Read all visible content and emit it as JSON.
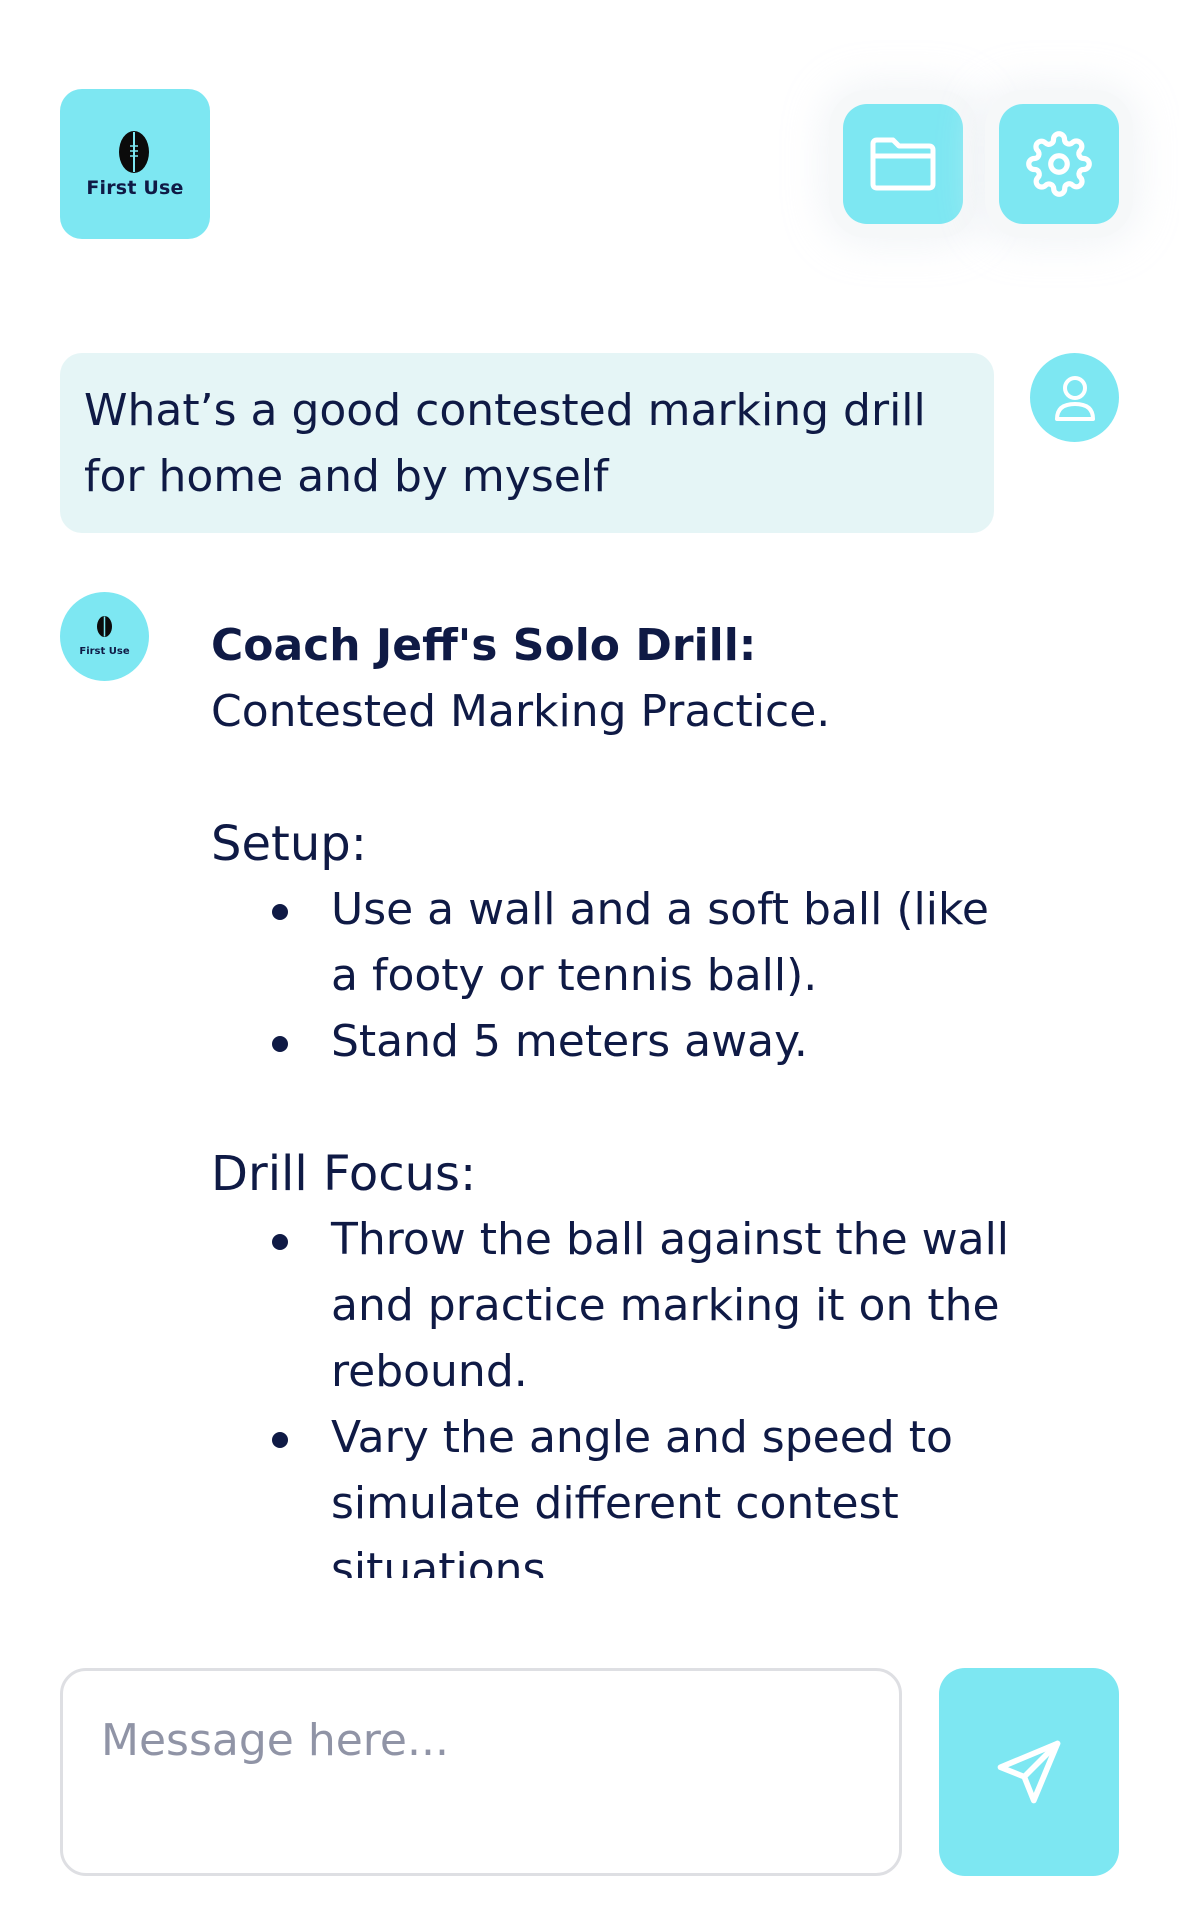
{
  "header": {
    "logo_text": "First Use",
    "folder_icon": "folder-icon",
    "settings_icon": "gear-icon"
  },
  "user_message": {
    "text": "What’s a good contested marking drill for home and by myself",
    "avatar_icon": "user-icon"
  },
  "bot_message": {
    "avatar_text": "First Use",
    "title": "Coach Jeff's Solo Drill:",
    "subtitle": "Contested Marking Practice.",
    "sections": [
      {
        "heading": "Setup:",
        "bullets": [
          "Use a wall and a soft ball (like a footy or tennis ball).",
          "Stand 5 meters away."
        ]
      },
      {
        "heading": "Drill Focus:",
        "bullets": [
          "Throw the ball against the wall and practice marking it on the rebound.",
          "Vary the angle and speed to simulate different contest situations."
        ]
      }
    ]
  },
  "composer": {
    "placeholder": "Message here...",
    "send_icon": "send-icon"
  },
  "colors": {
    "accent": "#7de7f2",
    "bubble": "#e5f5f6",
    "text": "#0f1a45",
    "placeholder": "#9094a6"
  }
}
